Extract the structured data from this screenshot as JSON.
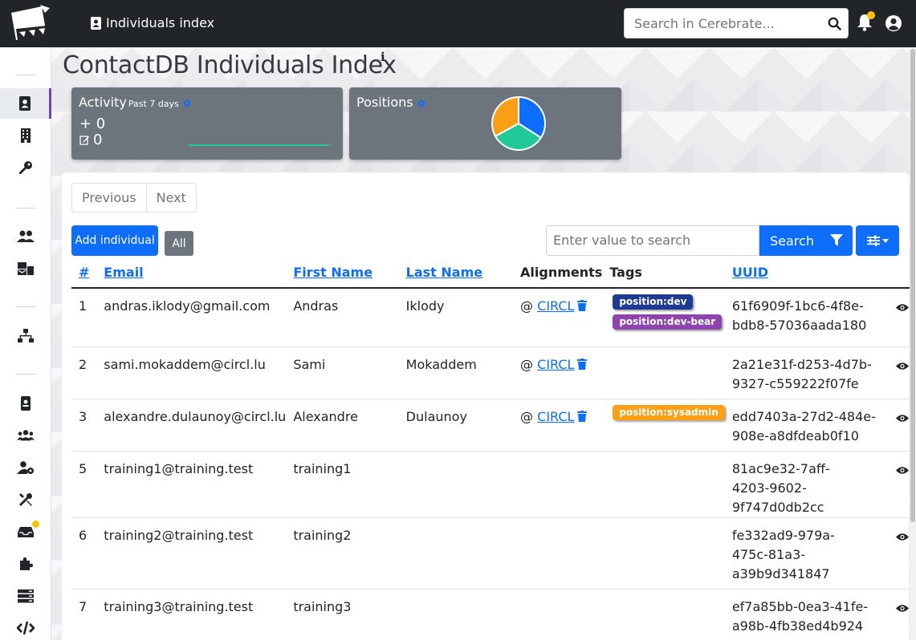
{
  "header": {
    "breadcrumb": "Individuals index",
    "search_placeholder": "Search in Cerebrate..."
  },
  "page": {
    "title": "ContactDB Individuals Index",
    "info_icon": "i"
  },
  "cards": {
    "activity": {
      "title": "Activity",
      "subtitle": "Past 7 days",
      "new_count": "+ 0",
      "edit_count": "0"
    },
    "positions": {
      "title": "Positions",
      "pie": [
        0.34,
        0.33,
        0.33
      ],
      "pie_colors": [
        "#0d6efd",
        "#20c997",
        "#fd9f14"
      ]
    }
  },
  "pagination": {
    "previous": "Previous",
    "next": "Next"
  },
  "actions": {
    "add_individual": "Add individual",
    "all": "All",
    "filter_placeholder": "Enter value to search",
    "search": "Search"
  },
  "table": {
    "headers": [
      "#",
      "Email",
      "First Name",
      "Last Name",
      "Alignments",
      "Tags",
      "UUID"
    ],
    "rows": [
      {
        "id": "1",
        "email": "andras.iklody@gmail.com",
        "first": "Andras",
        "last": "Iklody",
        "align_prefix": "@",
        "align": "CIRCL",
        "tags": [
          {
            "label": "position:dev",
            "color": "#1f3a93"
          },
          {
            "label": "position:dev-bear",
            "color": "#8e44ad"
          }
        ],
        "uuid1": "61f6909f-1bc6-4f8e-",
        "uuid2": "bdb8-57036aada180",
        "uuid3": ""
      },
      {
        "id": "2",
        "email": "sami.mokaddem@circl.lu",
        "first": "Sami",
        "last": "Mokaddem",
        "align_prefix": "@",
        "align": "CIRCL",
        "tags": [],
        "uuid1": "2a21e31f-d253-4d7b-",
        "uuid2": "9327-c559222f07fe",
        "uuid3": ""
      },
      {
        "id": "3",
        "email": "alexandre.dulaunoy@circl.lu",
        "first": "Alexandre",
        "last": "Dulaunoy",
        "align_prefix": "@",
        "align": "CIRCL",
        "tags": [
          {
            "label": "position:sysadmin",
            "color": "#fd9f14"
          }
        ],
        "uuid1": "edd7403a-27d2-484e-",
        "uuid2": "908e-a8dfdeab0f10",
        "uuid3": ""
      },
      {
        "id": "5",
        "email": "training1@training.test",
        "first": "training1",
        "last": "",
        "align_prefix": "",
        "align": "",
        "tags": [],
        "uuid1": "81ac9e32-7aff-",
        "uuid2": "4203-9602-9f747d0db2cc",
        "uuid3": ""
      },
      {
        "id": "6",
        "email": "training2@training.test",
        "first": "training2",
        "last": "",
        "align_prefix": "",
        "align": "",
        "tags": [],
        "uuid1": "fe332ad9-979a-",
        "uuid2": "475c-81a3-",
        "uuid3": "a39b9d341847"
      },
      {
        "id": "7",
        "email": "training3@training.test",
        "first": "training3",
        "last": "",
        "align_prefix": "",
        "align": "",
        "tags": [],
        "uuid1": "ef7a85bb-0ea3-41fe-",
        "uuid2": "a98b-4fb38ed4b924",
        "uuid3": ""
      }
    ]
  }
}
